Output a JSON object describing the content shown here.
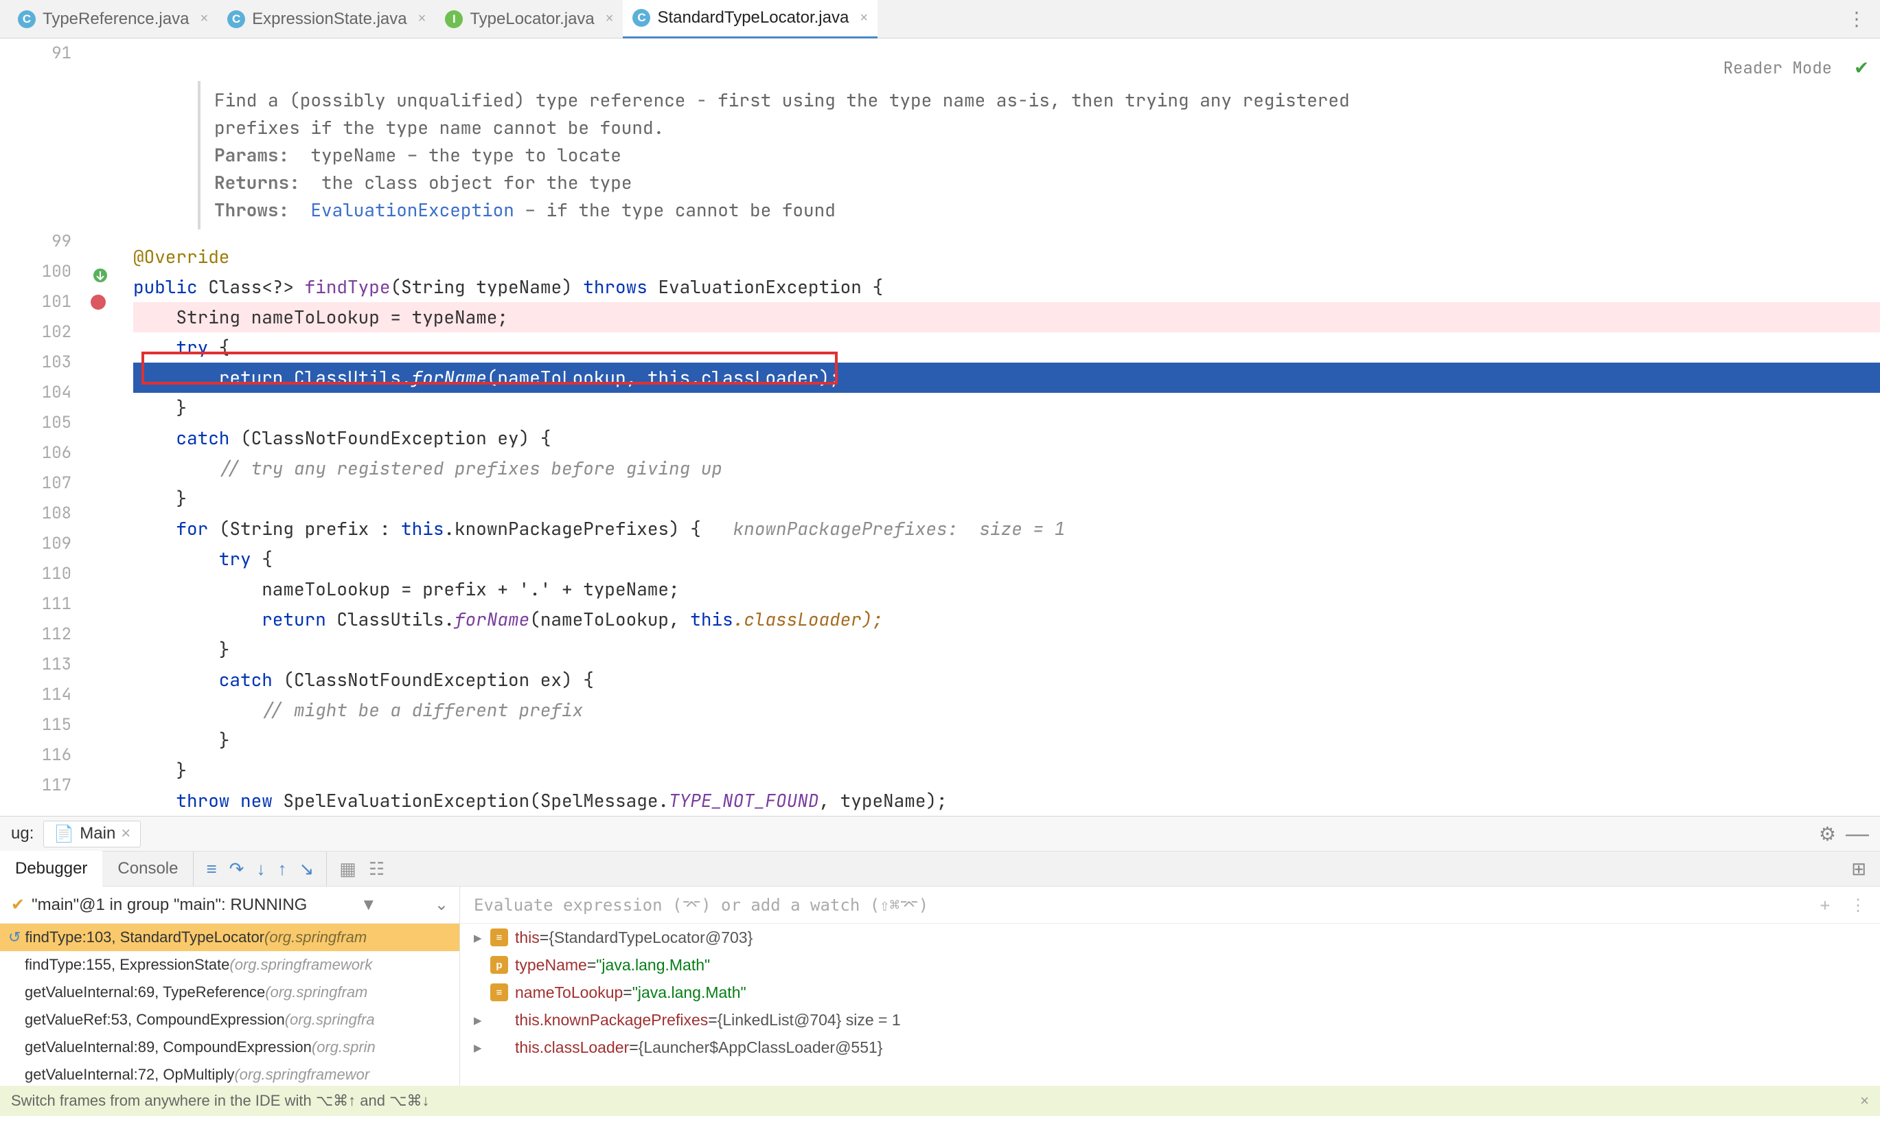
{
  "tabs": [
    {
      "icon": "C",
      "label": "TypeReference.java"
    },
    {
      "icon": "C",
      "label": "ExpressionState.java"
    },
    {
      "icon": "I",
      "label": "TypeLocator.java"
    },
    {
      "icon": "C",
      "label": "StandardTypeLocator.java"
    }
  ],
  "reader_mode": "Reader Mode",
  "gutter_start": 91,
  "jdoc": {
    "desc": "Find a (possibly unqualified) type reference - first using the type name as-is, then trying any registered prefixes if the type name cannot be found.",
    "params_label": "Params:",
    "params_val": "typeName – the type to locate",
    "returns_label": "Returns:",
    "returns_val": "the class object for the type",
    "throws_label": "Throws:",
    "throws_link": "EvaluationException",
    "throws_rest": " – if the type cannot be found"
  },
  "code": {
    "l99": "@Override",
    "l100_public": "public",
    "l100_class": " Class<?> ",
    "l100_find": "findType",
    "l100_sig": "(String typeName) ",
    "l100_throws": "throws",
    "l100_ex": " EvaluationException {",
    "l101": "    String nameToLookup = typeName;",
    "l102_try": "    try",
    "l102_brace": " {",
    "l103_ret": "        return ",
    "l103_cu": "ClassUtils.",
    "l103_fn": "forName",
    "l103_args": "(nameToLookup, ",
    "l103_this": "this",
    "l103_cl": ".classLoader);",
    "l104": "    }",
    "l105_catch": "    catch ",
    "l105_rest": "(ClassNotFoundException ey) {",
    "l106": "        // try any registered prefixes before giving up",
    "l107": "    }",
    "l108_for": "    for ",
    "l108_p1": "(String prefix : ",
    "l108_this": "this",
    "l108_kpp": ".knownPackagePrefixes) {   ",
    "l108_hint": "knownPackagePrefixes:  size = 1",
    "l109_try": "        try ",
    "l109_b": "{",
    "l110": "            nameToLookup = prefix + '.' + typeName;",
    "l111_ret": "            return ",
    "l111_cu": "ClassUtils.",
    "l111_fn": "forName",
    "l111_args": "(nameToLookup, ",
    "l111_this": "this",
    "l111_cl": ".classLoader);",
    "l112": "        }",
    "l113_catch": "        catch ",
    "l113_rest": "(ClassNotFoundException ex) {",
    "l114": "            // might be a different prefix",
    "l115": "        }",
    "l116": "    }",
    "l117_throw": "    throw new ",
    "l117_ex": "SpelEvaluationException",
    "l117_p1": "(SpelMessage.",
    "l117_tnf": "TYPE_NOT_FOUND",
    "l117_p2": ", typeName);",
    "l118": "}"
  },
  "debug": {
    "ug_label": "ug:",
    "main_tab": "Main",
    "tabs": [
      "Debugger",
      "Console"
    ],
    "thread": "\"main\"@1 in group \"main\": RUNNING",
    "frames": [
      {
        "m": "findType:103, StandardTypeLocator ",
        "pkg": "(org.springfram"
      },
      {
        "m": "findType:155, ExpressionState ",
        "pkg": "(org.springframework"
      },
      {
        "m": "getValueInternal:69, TypeReference ",
        "pkg": "(org.springfram"
      },
      {
        "m": "getValueRef:53, CompoundExpression ",
        "pkg": "(org.springfra"
      },
      {
        "m": "getValueInternal:89, CompoundExpression ",
        "pkg": "(org.sprin"
      },
      {
        "m": "getValueInternal:72, OpMultiply ",
        "pkg": "(org.springframewor"
      }
    ],
    "eval_placeholder": "Evaluate expression (⌤) or add a watch (⇧⌘⌤)",
    "vars": [
      {
        "arrow": true,
        "icon": "f",
        "name": "this",
        "eq": " = ",
        "val": "{StandardTypeLocator@703}"
      },
      {
        "arrow": false,
        "icon": "p",
        "name": "typeName",
        "eq": " = ",
        "str": "\"java.lang.Math\""
      },
      {
        "arrow": false,
        "icon": "f",
        "name": "nameToLookup",
        "eq": " = ",
        "str": "\"java.lang.Math\""
      },
      {
        "arrow": true,
        "icon": "oo",
        "name": "this.knownPackagePrefixes",
        "eq": " = ",
        "val": "{LinkedList@704}  size = 1"
      },
      {
        "arrow": true,
        "icon": "oo",
        "name": "this.classLoader",
        "eq": " = ",
        "val": "{Launcher$AppClassLoader@551}"
      }
    ]
  },
  "status": "Switch frames from anywhere in the IDE with ⌥⌘↑ and ⌥⌘↓"
}
